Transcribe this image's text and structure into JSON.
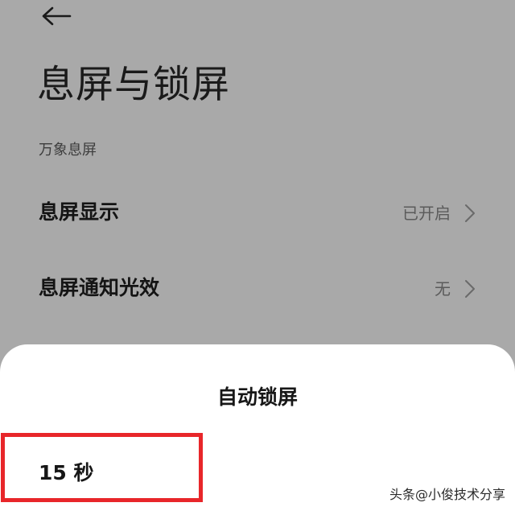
{
  "header": {
    "back_icon": "arrow-left-icon",
    "title": "息屏与锁屏"
  },
  "section": {
    "label": "万象息屏"
  },
  "settings": [
    {
      "title": "息屏显示",
      "value": "已开启",
      "icon": "chevron-right-icon"
    },
    {
      "title": "息屏通知光效",
      "value": "无",
      "icon": "chevron-right-icon"
    }
  ],
  "sheet": {
    "title": "自动锁屏",
    "options": [
      {
        "label": "15 秒"
      }
    ]
  },
  "watermark": {
    "text": "头条@小俊技术分享"
  },
  "colors": {
    "dim_background": "#a9a9a9",
    "sheet_background": "#ffffff",
    "highlight": "#e8262a"
  }
}
